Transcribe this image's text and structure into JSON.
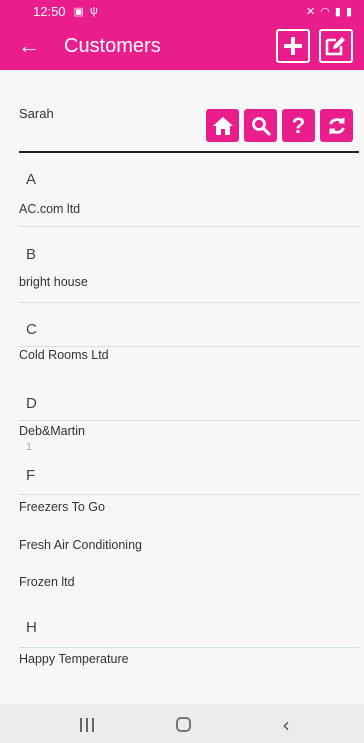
{
  "status_bar": {
    "time": "12:50"
  },
  "app_bar": {
    "back_icon": "←",
    "title": "Customers"
  },
  "user": {
    "name": "Sarah"
  },
  "toolbar": {
    "home_icon": "home-icon",
    "search_icon": "search-icon",
    "help_label": "?",
    "refresh_icon": "refresh-icon"
  },
  "colors": {
    "brand": "#e91e8c",
    "divider": "#cde2ea"
  },
  "sections": [
    {
      "letter": "A",
      "items": [
        "AC.com ltd"
      ]
    },
    {
      "letter": "B",
      "items": [
        "bright house"
      ]
    },
    {
      "letter": "C",
      "items": [
        "Cold Rooms Ltd"
      ]
    },
    {
      "letter": "D",
      "items": [
        "Deb&Martin"
      ],
      "sub": "1"
    },
    {
      "letter": "F",
      "items": [
        "Freezers To Go",
        "Fresh Air Conditioning",
        "Frozen ltd"
      ]
    },
    {
      "letter": "H",
      "items": [
        "Happy Temperature"
      ]
    }
  ]
}
